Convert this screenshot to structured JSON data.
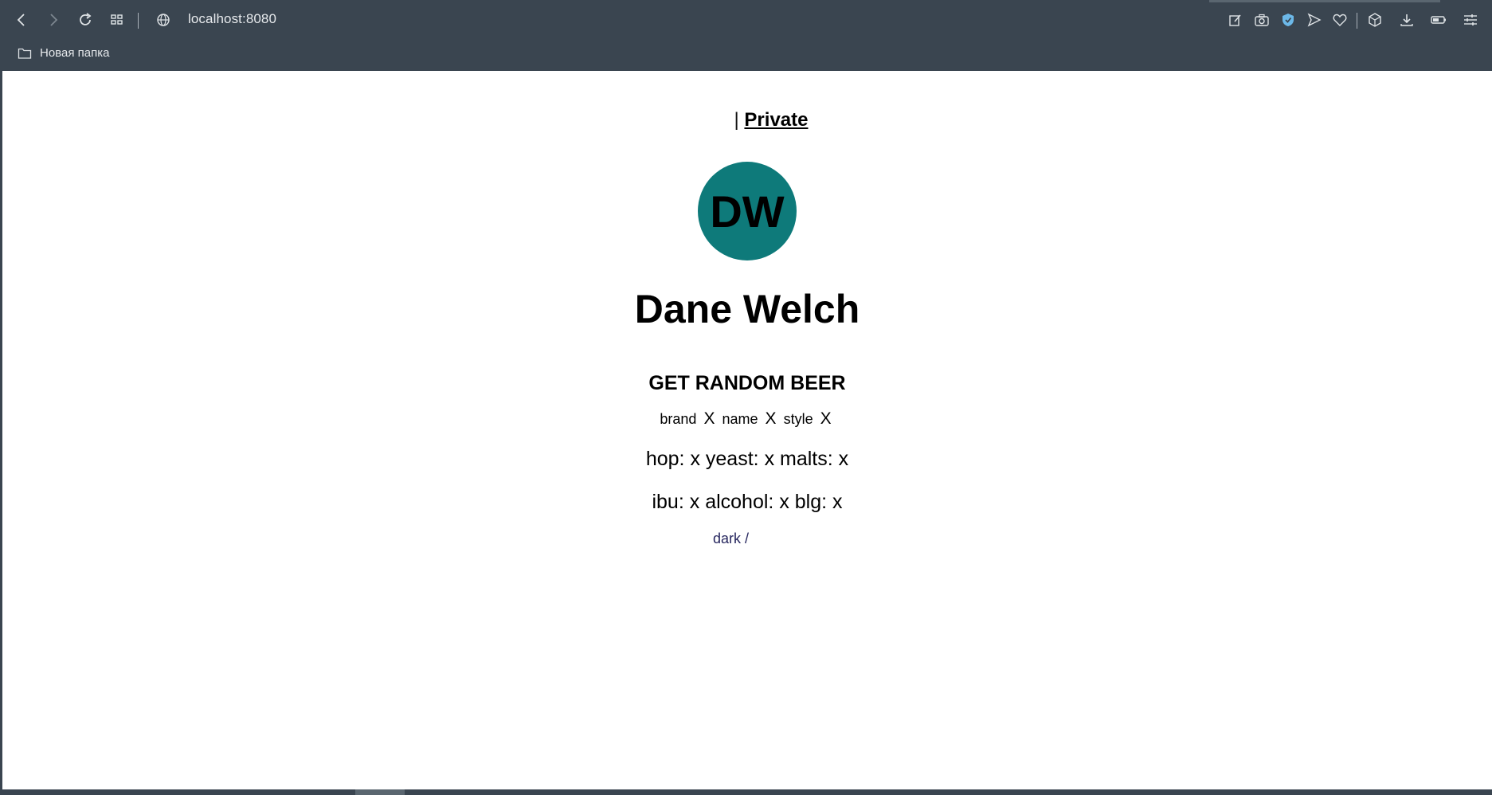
{
  "browser": {
    "url": "localhost:8080",
    "bookmark_folder": "Новая папка"
  },
  "nav": {
    "separator": "|",
    "private_link": "Private"
  },
  "profile": {
    "initials": "DW",
    "name": "Dane Welch",
    "avatar_color": "#0e7a7a"
  },
  "beer": {
    "button_label": "GET RANDOM BEER",
    "brand_label": "brand",
    "brand_value": "X",
    "name_label": "name",
    "name_value": "X",
    "style_label": "style",
    "style_value": "X",
    "hop_label": "hop:",
    "hop_value": "x",
    "yeast_label": "yeast:",
    "yeast_value": "x",
    "malts_label": "malts:",
    "malts_value": "x",
    "ibu_label": "ibu:",
    "ibu_value": "x",
    "alcohol_label": "alcohol:",
    "alcohol_value": "x",
    "blg_label": "blg:",
    "blg_value": "x"
  },
  "theme": {
    "label": "dark",
    "suffix": "/"
  }
}
